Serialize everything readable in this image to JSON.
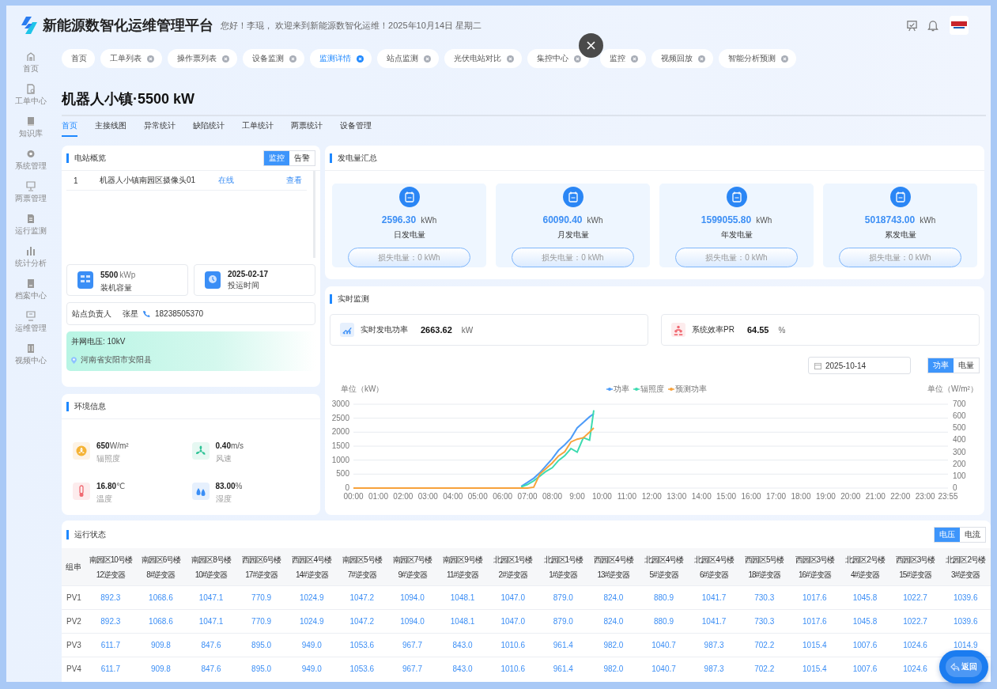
{
  "header": {
    "title": "新能源数智化运维管理平台",
    "greeting": "您好！李琨， 欢迎来到新能源数智化运维！2025年10月14日 星期二"
  },
  "sidebar": {
    "items": [
      {
        "label": "首页"
      },
      {
        "label": "工单中心"
      },
      {
        "label": "知识库"
      },
      {
        "label": "系统管理"
      },
      {
        "label": "两票管理"
      },
      {
        "label": "运行监测"
      },
      {
        "label": "统计分析"
      },
      {
        "label": "档案中心"
      },
      {
        "label": "运维管理"
      },
      {
        "label": "视频中心"
      }
    ]
  },
  "tabs": [
    {
      "label": "首页",
      "closable": false,
      "selected": false,
      "covered": false
    },
    {
      "label": "工单列表",
      "closable": true,
      "selected": false,
      "covered": false
    },
    {
      "label": "操作票列表",
      "closable": true,
      "selected": false,
      "covered": false
    },
    {
      "label": "设备监测",
      "closable": true,
      "selected": false,
      "covered": false
    },
    {
      "label": "监测详情",
      "closable": true,
      "selected": true,
      "covered": false
    },
    {
      "label": "站点监测",
      "closable": true,
      "selected": false,
      "covered": false
    },
    {
      "label": "光伏电站对比",
      "closable": true,
      "selected": false,
      "covered": false
    },
    {
      "label": "集控中心",
      "closable": true,
      "selected": false,
      "covered": false
    },
    {
      "label": "监控",
      "closable": true,
      "selected": false,
      "covered": true
    },
    {
      "label": "视频回放",
      "closable": true,
      "selected": false,
      "covered": false
    },
    {
      "label": "智能分析预测",
      "closable": true,
      "selected": false,
      "covered": false
    }
  ],
  "page_title": "机器人小镇·5500 kW",
  "subtabs": [
    {
      "label": "首页",
      "selected": true
    },
    {
      "label": "主接线图",
      "selected": false
    },
    {
      "label": "异常统计",
      "selected": false
    },
    {
      "label": "缺陷统计",
      "selected": false
    },
    {
      "label": "工单统计",
      "selected": false
    },
    {
      "label": "两票统计",
      "selected": false
    },
    {
      "label": "设备管理",
      "selected": false
    }
  ],
  "station_overview": {
    "title": "电站概览",
    "toggle": [
      {
        "label": "监控",
        "selected": true
      },
      {
        "label": "告警",
        "selected": false
      }
    ],
    "cameras": [
      {
        "index": "1",
        "name": "机器人小镇南园区摄像头01",
        "status": "在线",
        "action": "查看"
      }
    ],
    "capacity": {
      "value": "5500",
      "unit": "kWp",
      "label": "装机容量"
    },
    "commission": {
      "value": "2025-02-17",
      "label": "投运时间"
    },
    "contact": {
      "label": "站点负责人",
      "name": "张星",
      "phone": "18238505370"
    },
    "grid": {
      "voltage": "并网电压: 10kV",
      "address": "河南省安阳市安阳县"
    }
  },
  "environment": {
    "title": "环境信息",
    "items": [
      {
        "kind": "irradiance",
        "value": "650",
        "unit": "W/m²",
        "label": "辐照度"
      },
      {
        "kind": "wind",
        "value": "0.40",
        "unit": "m/s",
        "label": "风速"
      },
      {
        "kind": "temperature",
        "value": "16.80",
        "unit": "℃",
        "label": "温度"
      },
      {
        "kind": "humidity",
        "value": "83.00",
        "unit": "%",
        "label": "湿度"
      }
    ]
  },
  "energy_summary": {
    "title": "发电量汇总",
    "cards": [
      {
        "value": "2596.30",
        "unit": "kWh",
        "label": "日发电量",
        "loss": "损失电量：0 kWh"
      },
      {
        "value": "60090.40",
        "unit": "kWh",
        "label": "月发电量",
        "loss": "损失电量：0 kWh"
      },
      {
        "value": "1599055.80",
        "unit": "kWh",
        "label": "年发电量",
        "loss": "损失电量：0 kWh"
      },
      {
        "value": "5018743.00",
        "unit": "kWh",
        "label": "累发电量",
        "loss": "损失电量：0 kWh"
      }
    ]
  },
  "realtime": {
    "title": "实时监测",
    "stats": [
      {
        "kind": "power",
        "label": "实时发电功率",
        "value": "2663.62",
        "unit": "kW"
      },
      {
        "kind": "efficiency",
        "label": "系统效率PR",
        "value": "64.55",
        "unit": "%"
      }
    ],
    "date": "2025-10-14",
    "toggle": [
      {
        "label": "功率",
        "selected": true
      },
      {
        "label": "电量",
        "selected": false
      }
    ],
    "chart_data": {
      "type": "line",
      "grid": true,
      "legend": "top",
      "ylabel": "单位（kW）",
      "y2label": "单位（W/m²）",
      "xlim": [
        0,
        23.917
      ],
      "ylim": [
        0,
        3000
      ],
      "y2lim": [
        0,
        700
      ],
      "yticks": [
        0,
        500,
        1000,
        1500,
        2000,
        2500,
        3000
      ],
      "y2ticks": [
        0,
        100,
        200,
        300,
        400,
        500,
        600,
        700
      ],
      "xticks": [
        {
          "value": 0,
          "label": "00:00"
        },
        {
          "value": 1,
          "label": "01:00"
        },
        {
          "value": 2,
          "label": "02:00"
        },
        {
          "value": 3,
          "label": "03:00"
        },
        {
          "value": 4,
          "label": "04:00"
        },
        {
          "value": 5,
          "label": "05:00"
        },
        {
          "value": 6,
          "label": "06:00"
        },
        {
          "value": 7,
          "label": "07:00"
        },
        {
          "value": 8,
          "label": "08:00"
        },
        {
          "value": 9,
          "label": "9:00"
        },
        {
          "value": 10,
          "label": "10:00"
        },
        {
          "value": 11,
          "label": "11:00"
        },
        {
          "value": 12,
          "label": "12:00"
        },
        {
          "value": 13,
          "label": "13:00"
        },
        {
          "value": 14,
          "label": "14:00"
        },
        {
          "value": 15,
          "label": "15:00"
        },
        {
          "value": 16,
          "label": "16:00"
        },
        {
          "value": 17,
          "label": "17:00"
        },
        {
          "value": 18,
          "label": "18:00"
        },
        {
          "value": 19,
          "label": "19:00"
        },
        {
          "value": 20,
          "label": "20:00"
        },
        {
          "value": 21,
          "label": "21:00"
        },
        {
          "value": 22,
          "label": "22:00"
        },
        {
          "value": 23,
          "label": "23:00"
        },
        {
          "value": 23.917,
          "label": "23:55"
        }
      ],
      "x": [
        0,
        1,
        2,
        3,
        4,
        5,
        6,
        6.5,
        6.75,
        7,
        7.25,
        7.5,
        7.75,
        8,
        8.25,
        8.5,
        8.75,
        9,
        9.25,
        9.5,
        9.67
      ],
      "series": [
        {
          "name": "功率",
          "color": "#4d9cf8",
          "values": [
            null,
            null,
            null,
            null,
            null,
            null,
            null,
            null,
            60,
            200,
            350,
            550,
            800,
            1050,
            1350,
            1550,
            1780,
            2150,
            2350,
            2550,
            2660
          ]
        },
        {
          "name": "辐照度",
          "color": "#3ddbb0",
          "axis": "y2",
          "values": [
            null,
            null,
            null,
            null,
            null,
            null,
            null,
            null,
            10,
            30,
            60,
            100,
            140,
            170,
            230,
            270,
            330,
            300,
            420,
            400,
            650
          ]
        },
        {
          "name": "预测功率",
          "color": "#f7a23b",
          "values": [
            0,
            0,
            0,
            0,
            0,
            0,
            0,
            0,
            0,
            0,
            30,
            500,
            700,
            900,
            1150,
            1300,
            1650,
            1750,
            1800,
            2000,
            2150
          ]
        }
      ]
    }
  },
  "run_status": {
    "title": "运行状态",
    "toggle": [
      {
        "label": "电压",
        "selected": true
      },
      {
        "label": "电流",
        "selected": false
      }
    ],
    "row_header": "组串",
    "columns": [
      {
        "building": "南园区10号楼",
        "inverter": "12逆变器"
      },
      {
        "building": "南园区6号楼",
        "inverter": "8#逆变器"
      },
      {
        "building": "南园区8号楼",
        "inverter": "10#逆变器"
      },
      {
        "building": "西园区6号楼",
        "inverter": "17#逆变器"
      },
      {
        "building": "西园区4号楼",
        "inverter": "14#逆变器"
      },
      {
        "building": "南园区5号楼",
        "inverter": "7#逆变器"
      },
      {
        "building": "南园区7号楼",
        "inverter": "9#逆变器"
      },
      {
        "building": "南园区9号楼",
        "inverter": "11#逆变器"
      },
      {
        "building": "北园区1号楼",
        "inverter": "2#逆变器"
      },
      {
        "building": "北园区1号楼",
        "inverter": "1#逆变器"
      },
      {
        "building": "西园区4号楼",
        "inverter": "13#逆变器"
      },
      {
        "building": "北园区4号楼",
        "inverter": "5#逆变器"
      },
      {
        "building": "北园区4号楼",
        "inverter": "6#逆变器"
      },
      {
        "building": "西园区5号楼",
        "inverter": "18#逆变器"
      },
      {
        "building": "西园区3号楼",
        "inverter": "16#逆变器"
      },
      {
        "building": "北园区2号楼",
        "inverter": "4#逆变器"
      },
      {
        "building": "西园区3号楼",
        "inverter": "15#逆变器"
      },
      {
        "building": "北园区2号楼",
        "inverter": "3#逆变器"
      }
    ],
    "rows": [
      {
        "name": "PV1",
        "values": [
          "892.3",
          "1068.6",
          "1047.1",
          "770.9",
          "1024.9",
          "1047.2",
          "1094.0",
          "1048.1",
          "1047.0",
          "879.0",
          "824.0",
          "880.9",
          "1041.7",
          "730.3",
          "1017.6",
          "1045.8",
          "1022.7",
          "1039.6"
        ]
      },
      {
        "name": "PV2",
        "values": [
          "892.3",
          "1068.6",
          "1047.1",
          "770.9",
          "1024.9",
          "1047.2",
          "1094.0",
          "1048.1",
          "1047.0",
          "879.0",
          "824.0",
          "880.9",
          "1041.7",
          "730.3",
          "1017.6",
          "1045.8",
          "1022.7",
          "1039.6"
        ]
      },
      {
        "name": "PV3",
        "values": [
          "611.7",
          "909.8",
          "847.6",
          "895.0",
          "949.0",
          "1053.6",
          "967.7",
          "843.0",
          "1010.6",
          "961.4",
          "982.0",
          "1040.7",
          "987.3",
          "702.2",
          "1015.4",
          "1007.6",
          "1024.6",
          "1014.9"
        ]
      },
      {
        "name": "PV4",
        "values": [
          "611.7",
          "909.8",
          "847.6",
          "895.0",
          "949.0",
          "1053.6",
          "967.7",
          "843.0",
          "1010.6",
          "961.4",
          "982.0",
          "1040.7",
          "987.3",
          "702.2",
          "1015.4",
          "1007.6",
          "1024.6"
        ]
      }
    ]
  },
  "back_button": {
    "label": "返回"
  }
}
